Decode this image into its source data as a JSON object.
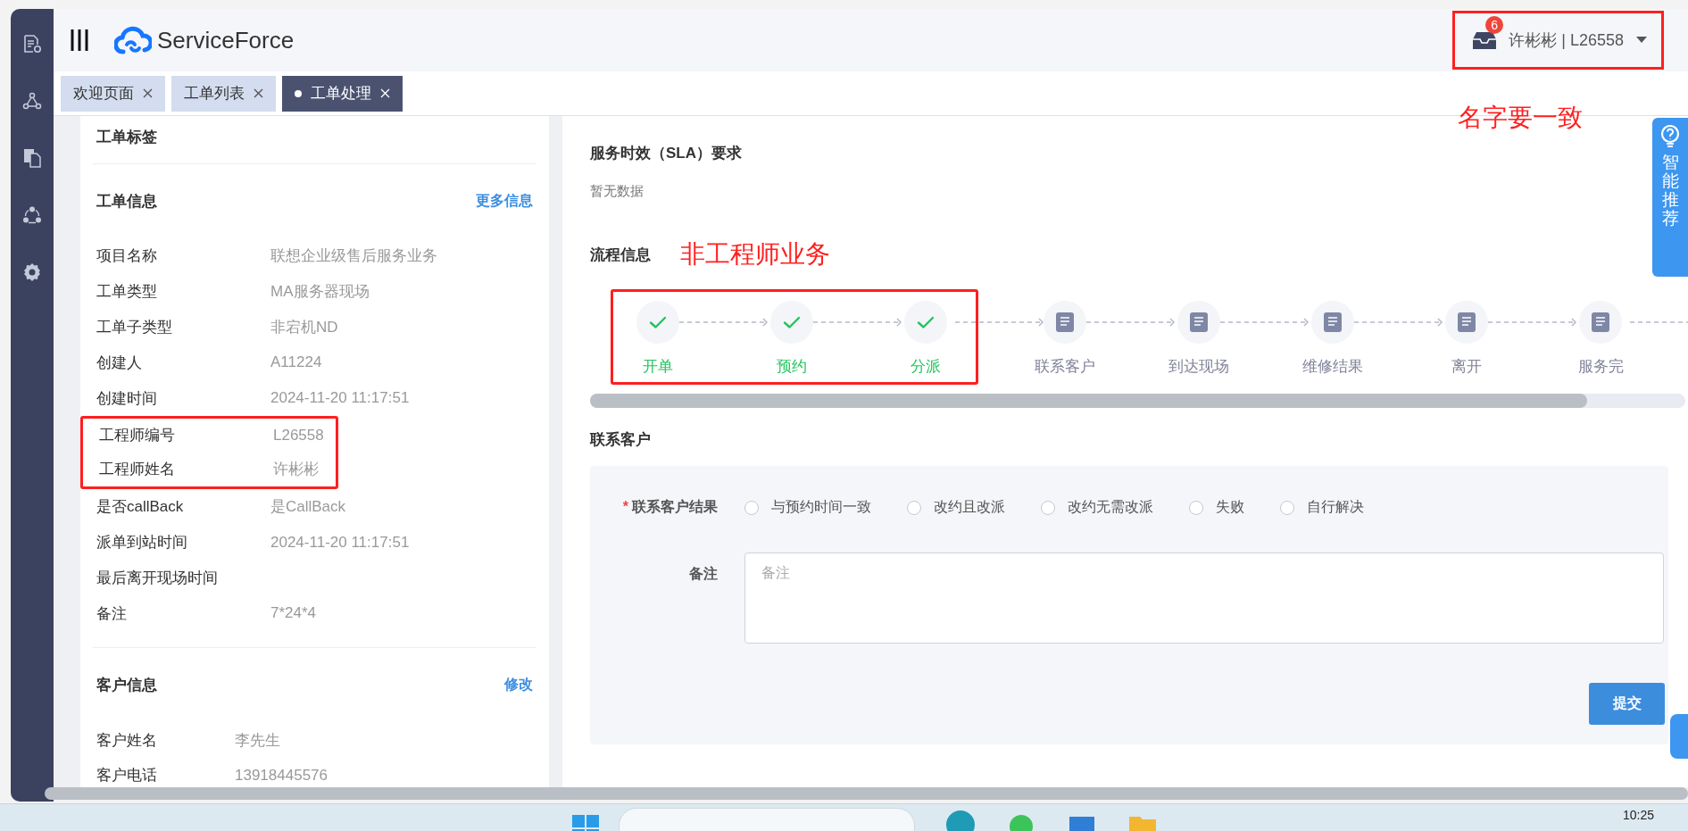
{
  "header": {
    "logo_text": "ServiceForce",
    "notification_count": "6",
    "user": "许彬彬 | L26558",
    "user_highlighted": true
  },
  "tabs": [
    {
      "label": "欢迎页面",
      "selected": false
    },
    {
      "label": "工单列表",
      "selected": false
    },
    {
      "label": "工单处理",
      "selected": true
    }
  ],
  "left_panel": {
    "tag_section": {
      "title": "工单标签"
    },
    "order_info": {
      "title": "工单信息",
      "link": "更多信息",
      "fields": [
        {
          "label": "项目名称",
          "value": "联想企业级售后服务业务",
          "highlighted": false
        },
        {
          "label": "工单类型",
          "value": "MA服务器现场",
          "highlighted": false
        },
        {
          "label": "工单子类型",
          "value": "非宕机ND",
          "highlighted": false
        },
        {
          "label": "创建人",
          "value": "A11224",
          "highlighted": false
        },
        {
          "label": "创建时间",
          "value": "2024-11-20 11:17:51",
          "highlighted": false
        },
        {
          "label": "工程师编号",
          "value": "L26558",
          "highlighted": true
        },
        {
          "label": "工程师姓名",
          "value": "许彬彬",
          "highlighted": true
        },
        {
          "label": "是否callBack",
          "value": "是CallBack",
          "highlighted": false
        },
        {
          "label": "派单到站时间",
          "value": "2024-11-20 11:17:51",
          "highlighted": false
        },
        {
          "label": "最后离开现场时间",
          "highlighted": false
        },
        {
          "label": "备注",
          "value": "7*24*4",
          "highlighted": false
        }
      ]
    },
    "customer_info": {
      "title": "客户信息",
      "link": "修改",
      "fields": [
        {
          "label": "客户姓名",
          "value": "李先生",
          "highlighted": false
        },
        {
          "label": "客户电话",
          "value": "13918445576",
          "highlighted": false
        }
      ]
    }
  },
  "right_panel": {
    "sla": {
      "title": "服务时效（SLA）要求",
      "empty_text": "暂无数据"
    },
    "process": {
      "title": "流程信息",
      "steps": [
        {
          "label": "开单",
          "done": true,
          "highlighted": true
        },
        {
          "label": "预约",
          "done": true,
          "highlighted": true
        },
        {
          "label": "分派",
          "done": true,
          "highlighted": true
        },
        {
          "label": "联系客户",
          "done": false,
          "highlighted": false
        },
        {
          "label": "到达现场",
          "done": false,
          "highlighted": false
        },
        {
          "label": "维修结果",
          "done": false,
          "highlighted": false
        },
        {
          "label": "离开",
          "done": false,
          "highlighted": false
        },
        {
          "label": "服务完",
          "done": false,
          "highlighted": false
        }
      ]
    },
    "contact": {
      "title": "联系客户",
      "result_label": "联系客户结果",
      "required": true,
      "required_mark": "*",
      "options": [
        {
          "label": "与预约时间一致",
          "selected": false
        },
        {
          "label": "改约且改派",
          "selected": false
        },
        {
          "label": "改约无需改派",
          "selected": false
        },
        {
          "label": "失败",
          "selected": false
        },
        {
          "label": "自行解决",
          "selected": false
        }
      ],
      "notes_label": "备注",
      "notes_placeholder": "备注",
      "submit": "提交"
    }
  },
  "side_tab": {
    "label": "智能推荐"
  },
  "annotations": {
    "user_note": "名字要一致",
    "process_note": "非工程师业务"
  },
  "taskbar": {
    "time": "10:25"
  }
}
